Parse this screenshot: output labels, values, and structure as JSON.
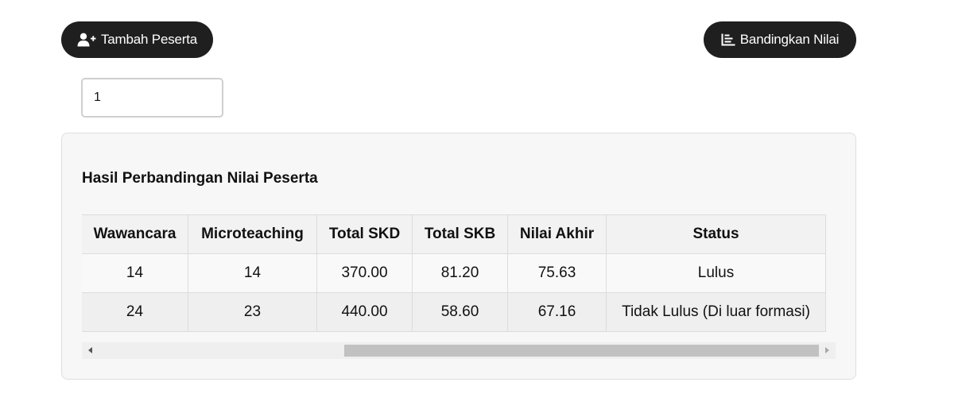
{
  "toolbar": {
    "add_participant_label": "Tambah Peserta",
    "compare_label": "Bandingkan Nilai"
  },
  "input": {
    "value": "1"
  },
  "results": {
    "title": "Hasil Perbandingan Nilai Peserta",
    "columns": [
      "Wawancara",
      "Microteaching",
      "Total SKD",
      "Total SKB",
      "Nilai Akhir",
      "Status"
    ],
    "rows": [
      [
        "14",
        "14",
        "370.00",
        "81.20",
        "75.63",
        "Lulus"
      ],
      [
        "24",
        "23",
        "440.00",
        "58.60",
        "67.16",
        "Tidak Lulus (Di luar formasi)"
      ]
    ]
  },
  "icons": {
    "add": "user-plus-icon",
    "compare": "bar-chart-icon"
  },
  "colors": {
    "button_bg": "#1f1f1f",
    "button_text": "#ffffff",
    "panel_bg": "#f7f7f7"
  }
}
